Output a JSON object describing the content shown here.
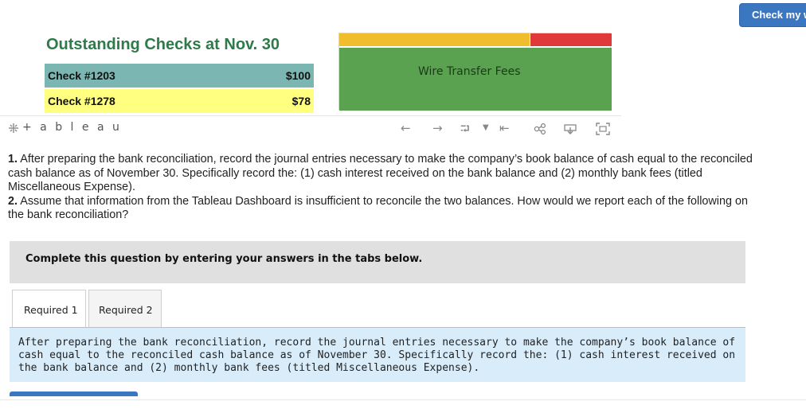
{
  "header": {
    "check_button_label": "Check my work"
  },
  "viz": {
    "title": "Outstanding Checks at Nov. 30",
    "checks": [
      {
        "label": "Check #1203",
        "amount": "$100",
        "color": "#7bb6b2"
      },
      {
        "label": "Check #1278",
        "amount": "$78",
        "color": "#ffff80"
      }
    ],
    "treemap": {
      "main_label": "Wire Transfer Fees",
      "colors": {
        "yellow": "#f0be2c",
        "red": "#e0393a",
        "green": "#5aa24f"
      }
    },
    "toolbar": {
      "logo_text": "+ a b l e a u",
      "icons": [
        "undo-icon",
        "redo-icon",
        "revert-icon",
        "dropdown-icon",
        "reset-icon",
        "share-icon",
        "download-icon",
        "fullscreen-icon"
      ]
    }
  },
  "question": {
    "p1_num": "1.",
    "p1_text": "After preparing the bank reconciliation, record the journal entries necessary to make the company’s book balance of cash equal to the reconciled cash balance as of November 30. Specifically record the: (1) cash interest received on the bank balance and (2) monthly bank fees (titled Miscellaneous Expense).",
    "p2_num": "2.",
    "p2_text": "Assume that information from the Tableau Dashboard is insufficient to reconcile the two balances. How would we report each of the following on the bank reconciliation?"
  },
  "complete_prompt": "Complete this question by entering your answers in the tabs below.",
  "tabs": [
    {
      "label": "Required 1"
    },
    {
      "label": "Required 2"
    }
  ],
  "instructions": "After preparing the bank reconciliation, record the journal entries necessary to make the company’s book balance of cash equal to the reconciled cash balance as of November 30. Specifically record the: (1) cash interest received on the bank balance and (2) monthly bank fees (titled Miscellaneous Expense)."
}
